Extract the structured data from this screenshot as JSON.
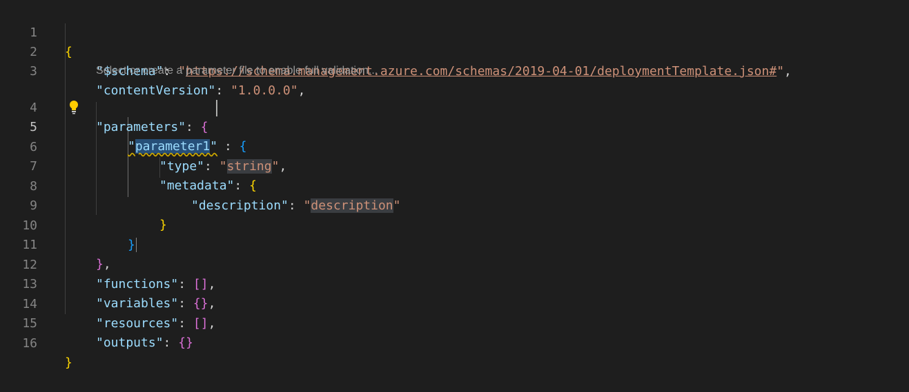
{
  "editor": {
    "line_numbers": [
      "1",
      "2",
      "3",
      "4",
      "5",
      "6",
      "7",
      "8",
      "9",
      "10",
      "11",
      "12",
      "13",
      "14",
      "15",
      "16"
    ],
    "codelens": "Select or create a parameter file to enable full validation...",
    "tokens": {
      "l1_open": "{",
      "schema_key": "\"$schema\"",
      "schema_q1": "\"",
      "schema_url": "https://schema.management.azure.com/schemas/2019-04-01/deploymentTemplate.json#",
      "schema_q2": "\"",
      "content_key": "\"contentVersion\"",
      "content_val": "\"1.0.0.0\"",
      "params_key": "\"parameters\"",
      "param1_q1": "\"",
      "param1_name": "parameter1",
      "param1_q2": "\"",
      "type_key": "\"type\"",
      "type_q1": "\"",
      "type_val": "string",
      "type_q2": "\"",
      "metadata_key": "\"metadata\"",
      "desc_key": "\"description\"",
      "desc_q1": "\"",
      "desc_val": "description",
      "desc_q2": "\"",
      "functions_key": "\"functions\"",
      "variables_key": "\"variables\"",
      "resources_key": "\"resources\"",
      "outputs_key": "\"outputs\"",
      "l16_close": "}"
    }
  },
  "icons": {
    "lightbulb": "lightbulb-icon"
  },
  "colors": {
    "background": "#1e1e1e",
    "key": "#9cdcfe",
    "string": "#ce9178",
    "bracket_level1": "#ffd700",
    "bracket_level2": "#da70d6",
    "bracket_level3": "#179fff",
    "selection": "#264f78"
  }
}
